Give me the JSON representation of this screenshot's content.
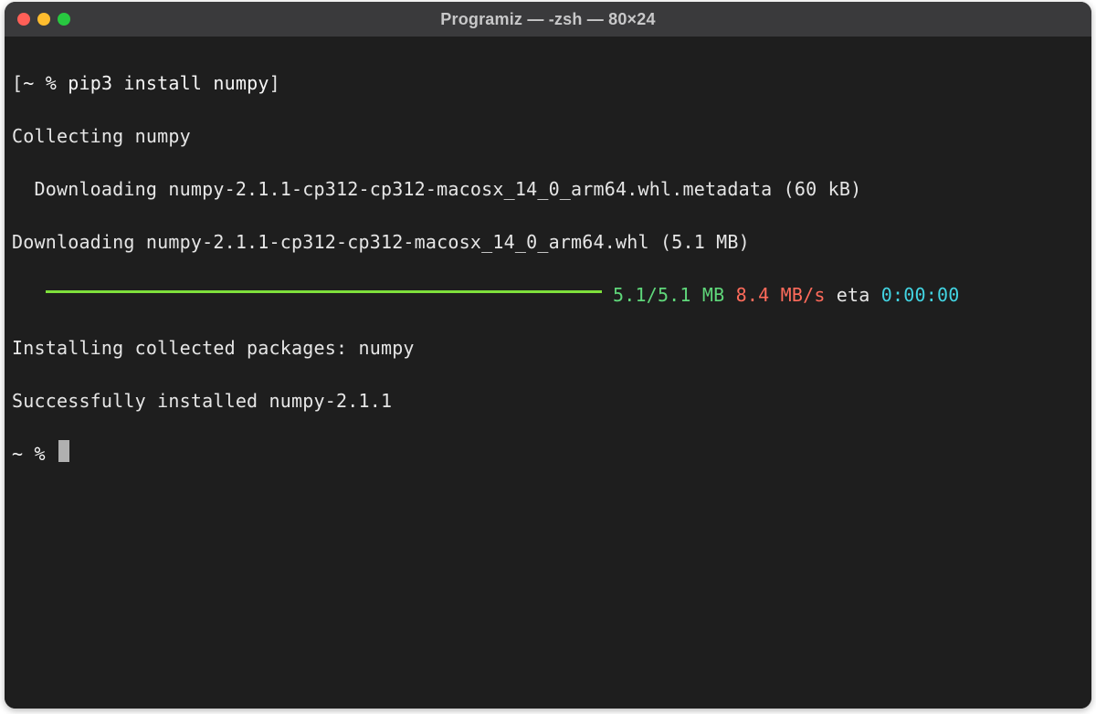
{
  "window": {
    "title": "Programiz — -zsh — 80×24"
  },
  "terminal": {
    "prompt_open_bracket": "[",
    "prompt1": "~ % ",
    "command1": "pip3 install numpy",
    "right_bracket": "]",
    "line2": "Collecting numpy",
    "line3": "  Downloading numpy-2.1.1-cp312-cp312-macosx_14_0_arm64.whl.metadata (60 kB)",
    "line4": "Downloading numpy-2.1.1-cp312-cp312-macosx_14_0_arm64.whl (5.1 MB)",
    "progress_indent": "   ",
    "progress_size": " 5.1/5.1 MB",
    "progress_speed": " 8.4 MB/s",
    "progress_eta_label": " eta ",
    "progress_eta": "0:00:00",
    "line6": "Installing collected packages: numpy",
    "line7": "Successfully installed numpy-2.1.1",
    "prompt2": "~ % "
  }
}
